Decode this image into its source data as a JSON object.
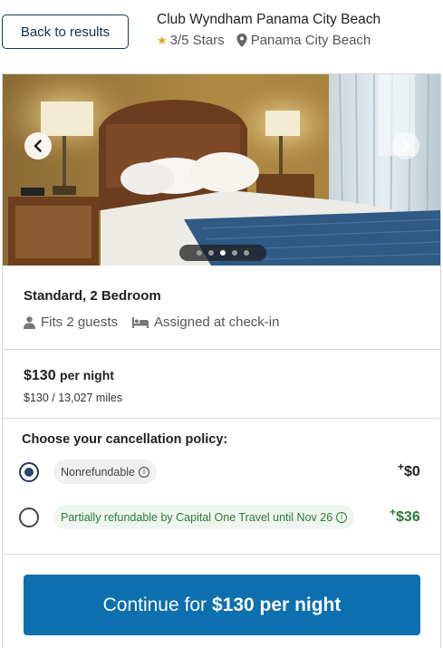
{
  "header": {
    "back_label": "Back to results",
    "hotel_name": "Club Wyndham Panama City Beach",
    "rating": "3/5 Stars",
    "location": "Panama City Beach"
  },
  "gallery": {
    "total_photos": 5,
    "active_photo": 3
  },
  "room": {
    "title": "Standard, 2 Bedroom",
    "guests": "Fits 2 guests",
    "bed": "Assigned at check-in"
  },
  "price": {
    "amount": "$130",
    "unit": "per night",
    "miles": "$130 / 13,027 miles"
  },
  "cancellation": {
    "title": "Choose your cancellation policy:",
    "options": [
      {
        "label": "Nonrefundable",
        "price_sign": "+",
        "price": "$0",
        "selected": true
      },
      {
        "label": "Partially refundable by Capital One Travel until Nov 26",
        "price_sign": "+",
        "price": "$36",
        "selected": false
      }
    ]
  },
  "cta": {
    "prefix": "Continue for",
    "price": "$130 per night"
  },
  "colors": {
    "primary_button": "#0c6fae",
    "refundable_green": "#2c7a39",
    "star": "#e5a31b"
  }
}
